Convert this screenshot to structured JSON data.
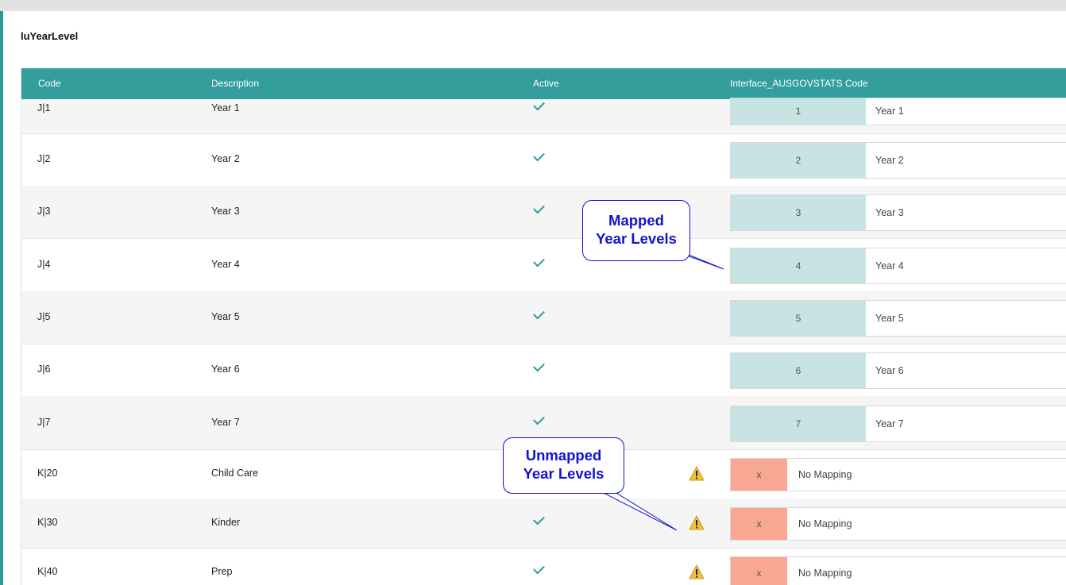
{
  "panel": {
    "title": "luYearLevel"
  },
  "table": {
    "columns": [
      "Code",
      "Description",
      "Active",
      "Interface_AUSGOVSTATS Code"
    ],
    "rows": [
      {
        "code": "J|1",
        "description": "Year 1",
        "active": true,
        "mapped": true,
        "map_code": "1",
        "map_label": "Year 1"
      },
      {
        "code": "J|2",
        "description": "Year 2",
        "active": true,
        "mapped": true,
        "map_code": "2",
        "map_label": "Year 2"
      },
      {
        "code": "J|3",
        "description": "Year 3",
        "active": true,
        "mapped": true,
        "map_code": "3",
        "map_label": "Year 3"
      },
      {
        "code": "J|4",
        "description": "Year 4",
        "active": true,
        "mapped": true,
        "map_code": "4",
        "map_label": "Year 4"
      },
      {
        "code": "J|5",
        "description": "Year 5",
        "active": true,
        "mapped": true,
        "map_code": "5",
        "map_label": "Year 5"
      },
      {
        "code": "J|6",
        "description": "Year 6",
        "active": true,
        "mapped": true,
        "map_code": "6",
        "map_label": "Year 6"
      },
      {
        "code": "J|7",
        "description": "Year 7",
        "active": true,
        "mapped": true,
        "map_code": "7",
        "map_label": "Year 7"
      },
      {
        "code": "K|20",
        "description": "Child Care",
        "active": false,
        "mapped": false,
        "map_code": "x",
        "map_label": "No Mapping"
      },
      {
        "code": "K|30",
        "description": "Kinder",
        "active": true,
        "mapped": false,
        "map_code": "x",
        "map_label": "No Mapping"
      },
      {
        "code": "K|40",
        "description": "Prep",
        "active": true,
        "mapped": false,
        "map_code": "x",
        "map_label": "No Mapping"
      }
    ]
  },
  "callouts": {
    "mapped": {
      "line1": "Mapped",
      "line2": "Year Levels"
    },
    "unmapped": {
      "line1": "Unmapped",
      "line2": "Year Levels"
    }
  },
  "colors": {
    "header": "#339e9b",
    "check": "#2f9a98",
    "mapped_fill": "#c7e3e3",
    "unmapped_fill": "#f8a792",
    "warning": "#f2c230",
    "callout": "#1212d0"
  },
  "icons": {
    "active": "check-icon",
    "warning": "warning-icon"
  }
}
